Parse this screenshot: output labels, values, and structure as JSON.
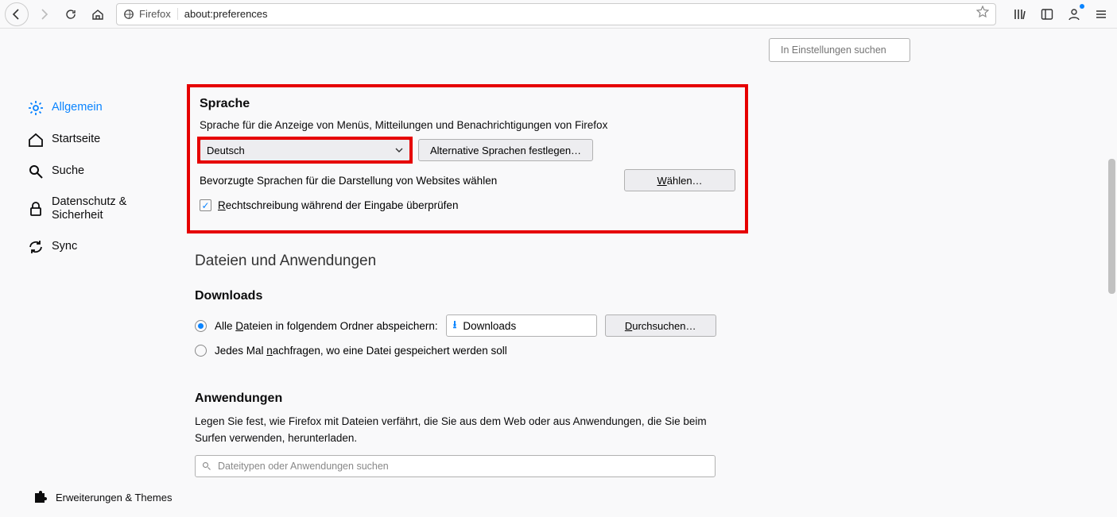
{
  "toolbar": {
    "identity_label": "Firefox",
    "url": "about:preferences"
  },
  "search": {
    "placeholder": "In Einstellungen suchen"
  },
  "sidebar": {
    "items": [
      {
        "label": "Allgemein"
      },
      {
        "label": "Startseite"
      },
      {
        "label": "Suche"
      },
      {
        "label": "Datenschutz & Sicherheit"
      },
      {
        "label": "Sync"
      }
    ],
    "footer": "Erweiterungen & Themes"
  },
  "language": {
    "heading": "Sprache",
    "desc": "Sprache für die Anzeige von Menüs, Mitteilungen und Benachrichtigungen von Firefox",
    "selected": "Deutsch",
    "alt_btn": "Alternative Sprachen festlegen…",
    "pref_sites": "Bevorzugte Sprachen für die Darstellung von Websites wählen",
    "choose_btn": "Wählen…",
    "spellcheck": "Rechtschreibung während der Eingabe überprüfen"
  },
  "files": {
    "section_title": "Dateien und Anwendungen",
    "downloads_heading": "Downloads",
    "save_all_label": "Alle Dateien in folgendem Ordner abspeichern:",
    "folder_name": "Downloads",
    "browse_btn": "Durchsuchen…",
    "ask_label": "Jedes Mal nachfragen, wo eine Datei gespeichert werden soll"
  },
  "apps": {
    "heading": "Anwendungen",
    "desc": "Legen Sie fest, wie Firefox mit Dateien verfährt, die Sie aus dem Web oder aus Anwendungen, die Sie beim Surfen verwenden, herunterladen.",
    "search_placeholder": "Dateitypen oder Anwendungen suchen"
  }
}
